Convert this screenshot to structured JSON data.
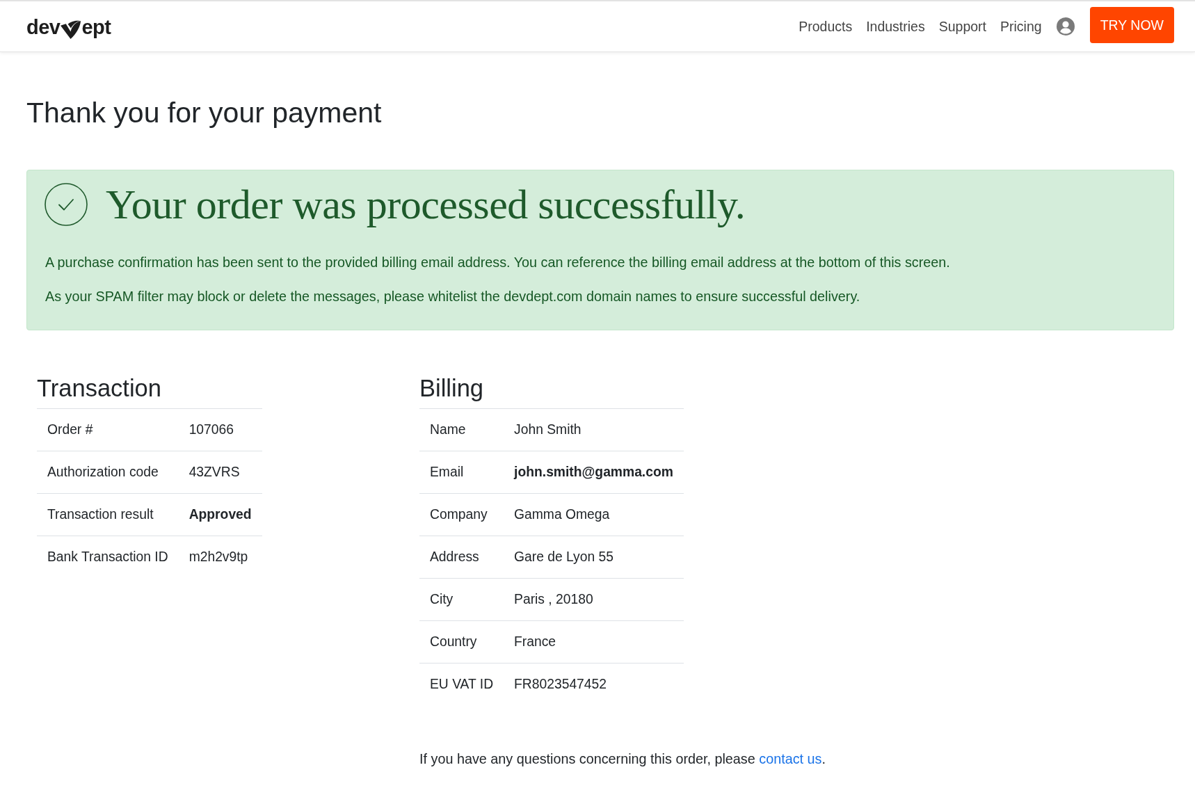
{
  "header": {
    "logo": {
      "left": "dev",
      "right": "ept"
    },
    "nav": [
      "Products",
      "Industries",
      "Support",
      "Pricing"
    ],
    "cta": "TRY NOW"
  },
  "page_title": "Thank you for your payment",
  "alert": {
    "title": "Your order was processed successfully.",
    "paragraphs": [
      "A purchase confirmation has been sent to the provided billing email address. You can reference the billing email address at the bottom of this screen.",
      "As your SPAM filter may block or delete the messages, please whitelist the devdept.com domain names to ensure successful delivery."
    ]
  },
  "transaction": {
    "title": "Transaction",
    "rows": [
      {
        "label": "Order #",
        "value": "107066",
        "bold": false
      },
      {
        "label": "Authorization code",
        "value": "43ZVRS",
        "bold": false
      },
      {
        "label": "Transaction result",
        "value": "Approved",
        "bold": true
      },
      {
        "label": "Bank Transaction ID",
        "value": "m2h2v9tp",
        "bold": false
      }
    ]
  },
  "billing": {
    "title": "Billing",
    "rows": [
      {
        "label": "Name",
        "value": "John Smith",
        "bold": false
      },
      {
        "label": "Email",
        "value": "john.smith@gamma.com",
        "bold": true
      },
      {
        "label": "Company",
        "value": "Gamma Omega",
        "bold": false
      },
      {
        "label": "Address",
        "value": "Gare de Lyon 55",
        "bold": false
      },
      {
        "label": "City",
        "value": "Paris , 20180",
        "bold": false
      },
      {
        "label": "Country",
        "value": "France",
        "bold": false
      },
      {
        "label": "EU VAT ID",
        "value": "FR8023547452",
        "bold": false
      }
    ]
  },
  "footer_note": {
    "text": "If you have any questions concerning this order, please",
    "link": "contact us",
    "after": "."
  }
}
